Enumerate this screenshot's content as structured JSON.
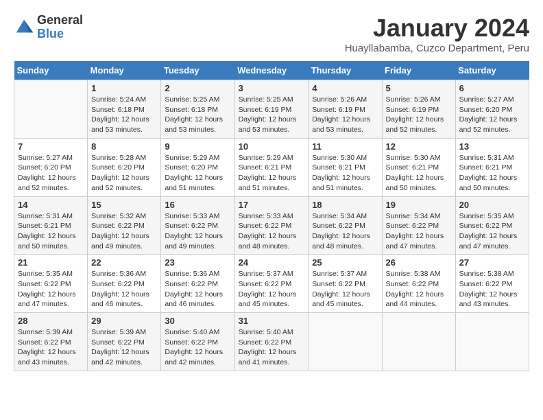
{
  "header": {
    "logo_general": "General",
    "logo_blue": "Blue",
    "month_title": "January 2024",
    "location": "Huayllabamba, Cuzco Department, Peru"
  },
  "days_of_week": [
    "Sunday",
    "Monday",
    "Tuesday",
    "Wednesday",
    "Thursday",
    "Friday",
    "Saturday"
  ],
  "weeks": [
    [
      {
        "day": "",
        "info": ""
      },
      {
        "day": "1",
        "info": "Sunrise: 5:24 AM\nSunset: 6:18 PM\nDaylight: 12 hours\nand 53 minutes."
      },
      {
        "day": "2",
        "info": "Sunrise: 5:25 AM\nSunset: 6:18 PM\nDaylight: 12 hours\nand 53 minutes."
      },
      {
        "day": "3",
        "info": "Sunrise: 5:25 AM\nSunset: 6:19 PM\nDaylight: 12 hours\nand 53 minutes."
      },
      {
        "day": "4",
        "info": "Sunrise: 5:26 AM\nSunset: 6:19 PM\nDaylight: 12 hours\nand 53 minutes."
      },
      {
        "day": "5",
        "info": "Sunrise: 5:26 AM\nSunset: 6:19 PM\nDaylight: 12 hours\nand 52 minutes."
      },
      {
        "day": "6",
        "info": "Sunrise: 5:27 AM\nSunset: 6:20 PM\nDaylight: 12 hours\nand 52 minutes."
      }
    ],
    [
      {
        "day": "7",
        "info": "Sunrise: 5:27 AM\nSunset: 6:20 PM\nDaylight: 12 hours\nand 52 minutes."
      },
      {
        "day": "8",
        "info": "Sunrise: 5:28 AM\nSunset: 6:20 PM\nDaylight: 12 hours\nand 52 minutes."
      },
      {
        "day": "9",
        "info": "Sunrise: 5:29 AM\nSunset: 6:20 PM\nDaylight: 12 hours\nand 51 minutes."
      },
      {
        "day": "10",
        "info": "Sunrise: 5:29 AM\nSunset: 6:21 PM\nDaylight: 12 hours\nand 51 minutes."
      },
      {
        "day": "11",
        "info": "Sunrise: 5:30 AM\nSunset: 6:21 PM\nDaylight: 12 hours\nand 51 minutes."
      },
      {
        "day": "12",
        "info": "Sunrise: 5:30 AM\nSunset: 6:21 PM\nDaylight: 12 hours\nand 50 minutes."
      },
      {
        "day": "13",
        "info": "Sunrise: 5:31 AM\nSunset: 6:21 PM\nDaylight: 12 hours\nand 50 minutes."
      }
    ],
    [
      {
        "day": "14",
        "info": "Sunrise: 5:31 AM\nSunset: 6:21 PM\nDaylight: 12 hours\nand 50 minutes."
      },
      {
        "day": "15",
        "info": "Sunrise: 5:32 AM\nSunset: 6:22 PM\nDaylight: 12 hours\nand 49 minutes."
      },
      {
        "day": "16",
        "info": "Sunrise: 5:33 AM\nSunset: 6:22 PM\nDaylight: 12 hours\nand 49 minutes."
      },
      {
        "day": "17",
        "info": "Sunrise: 5:33 AM\nSunset: 6:22 PM\nDaylight: 12 hours\nand 48 minutes."
      },
      {
        "day": "18",
        "info": "Sunrise: 5:34 AM\nSunset: 6:22 PM\nDaylight: 12 hours\nand 48 minutes."
      },
      {
        "day": "19",
        "info": "Sunrise: 5:34 AM\nSunset: 6:22 PM\nDaylight: 12 hours\nand 47 minutes."
      },
      {
        "day": "20",
        "info": "Sunrise: 5:35 AM\nSunset: 6:22 PM\nDaylight: 12 hours\nand 47 minutes."
      }
    ],
    [
      {
        "day": "21",
        "info": "Sunrise: 5:35 AM\nSunset: 6:22 PM\nDaylight: 12 hours\nand 47 minutes."
      },
      {
        "day": "22",
        "info": "Sunrise: 5:36 AM\nSunset: 6:22 PM\nDaylight: 12 hours\nand 46 minutes."
      },
      {
        "day": "23",
        "info": "Sunrise: 5:36 AM\nSunset: 6:22 PM\nDaylight: 12 hours\nand 46 minutes."
      },
      {
        "day": "24",
        "info": "Sunrise: 5:37 AM\nSunset: 6:22 PM\nDaylight: 12 hours\nand 45 minutes."
      },
      {
        "day": "25",
        "info": "Sunrise: 5:37 AM\nSunset: 6:22 PM\nDaylight: 12 hours\nand 45 minutes."
      },
      {
        "day": "26",
        "info": "Sunrise: 5:38 AM\nSunset: 6:22 PM\nDaylight: 12 hours\nand 44 minutes."
      },
      {
        "day": "27",
        "info": "Sunrise: 5:38 AM\nSunset: 6:22 PM\nDaylight: 12 hours\nand 43 minutes."
      }
    ],
    [
      {
        "day": "28",
        "info": "Sunrise: 5:39 AM\nSunset: 6:22 PM\nDaylight: 12 hours\nand 43 minutes."
      },
      {
        "day": "29",
        "info": "Sunrise: 5:39 AM\nSunset: 6:22 PM\nDaylight: 12 hours\nand 42 minutes."
      },
      {
        "day": "30",
        "info": "Sunrise: 5:40 AM\nSunset: 6:22 PM\nDaylight: 12 hours\nand 42 minutes."
      },
      {
        "day": "31",
        "info": "Sunrise: 5:40 AM\nSunset: 6:22 PM\nDaylight: 12 hours\nand 41 minutes."
      },
      {
        "day": "",
        "info": ""
      },
      {
        "day": "",
        "info": ""
      },
      {
        "day": "",
        "info": ""
      }
    ]
  ]
}
